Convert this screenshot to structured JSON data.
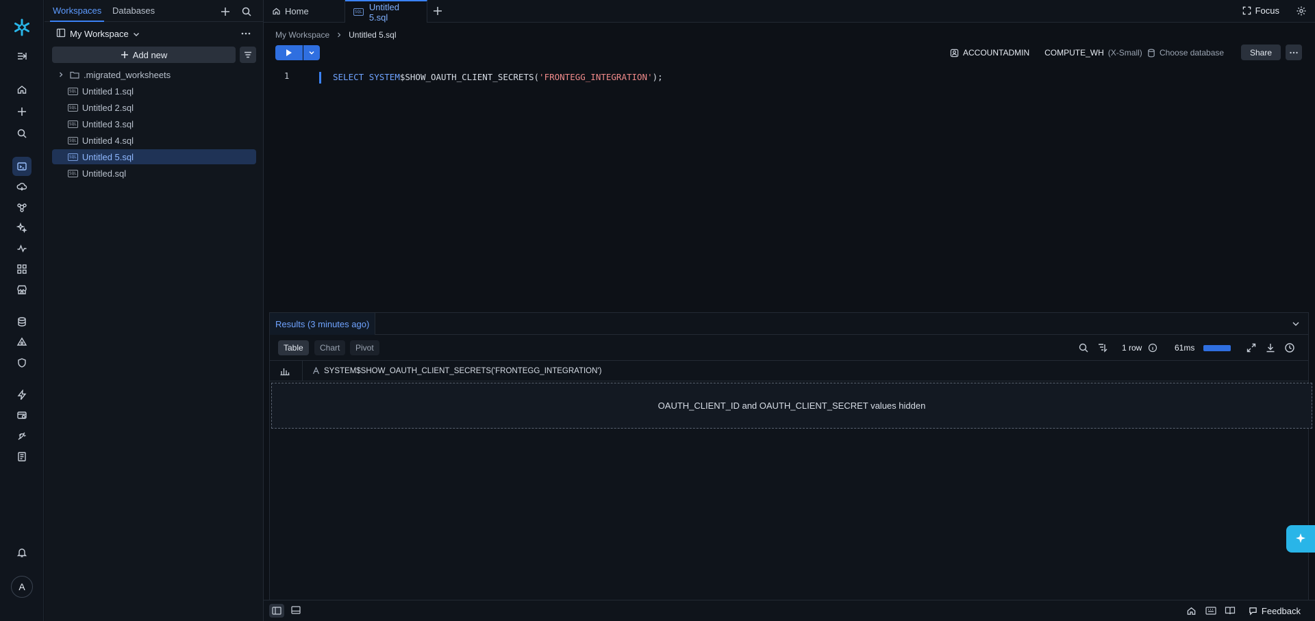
{
  "explorer": {
    "tabs": [
      "Workspaces",
      "Databases"
    ],
    "workspace_name": "My Workspace",
    "add_new_label": "Add new",
    "files": [
      ".migrated_worksheets",
      "Untitled 1.sql",
      "Untitled 2.sql",
      "Untitled 3.sql",
      "Untitled 4.sql",
      "Untitled 5.sql",
      "Untitled.sql"
    ],
    "active_file": "Untitled 5.sql"
  },
  "tabs": {
    "home": "Home",
    "active": "Untitled 5.sql",
    "sql_badge": "SQL"
  },
  "header": {
    "focus_label": "Focus"
  },
  "breadcrumb": [
    "My Workspace",
    "Untitled 5.sql"
  ],
  "context": {
    "role": "ACCOUNTADMIN",
    "warehouse": "COMPUTE_WH",
    "warehouse_size": "(X-Small)",
    "database_label": "Choose database",
    "share_label": "Share"
  },
  "editor": {
    "line_number": "1",
    "tokens": {
      "kw1": "SELECT",
      "kw2": "SYSTEM",
      "fn": "$SHOW_OAUTH_CLIENT_SECRETS(",
      "str": "'FRONTEGG_INTEGRATION'",
      "end": ");"
    }
  },
  "results": {
    "title": "Results (3 minutes ago)",
    "views": [
      "Table",
      "Chart",
      "Pivot"
    ],
    "active_view": "Table",
    "row_count": "1 row",
    "duration": "61ms",
    "column_header": "SYSTEM$SHOW_OAUTH_CLIENT_SECRETS('FRONTEGG_INTEGRATION')",
    "hidden_message": "OAUTH_CLIENT_ID and OAUTH_CLIENT_SECRET values hidden"
  },
  "rail": {
    "avatar_initial": "A",
    "items": [
      "home-icon",
      "create-icon",
      "search-icon",
      "worksheets-icon",
      "data-icon",
      "projects-icon",
      "ai-icon",
      "monitoring-icon",
      "apps-icon",
      "marketplace-icon",
      "databases-icon",
      "catalog-icon",
      "governance-icon",
      "activity-icon",
      "admin-icon",
      "help-icon",
      "docs-icon",
      "notifications-icon"
    ]
  },
  "statusbar": {
    "feedback_label": "Feedback"
  },
  "colors": {
    "accent": "#3b82f6",
    "brand": "#29b5e8",
    "background": "#0d1117",
    "string": "#f08a8a"
  }
}
